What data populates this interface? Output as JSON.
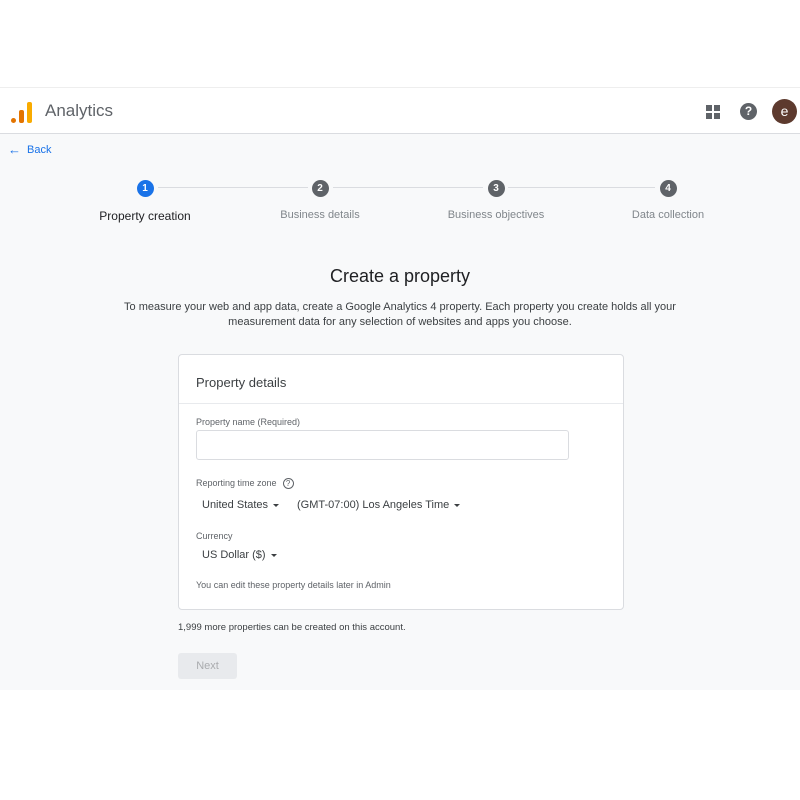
{
  "header": {
    "brand": "Analytics",
    "avatar_letter": "e",
    "icons": [
      "apps-grid-icon",
      "help-icon",
      "avatar"
    ]
  },
  "colors": {
    "accent": "#1a73e8",
    "logo_orange": "#e37400",
    "logo_yellow": "#f9ab00",
    "avatar": "#5d3a2e"
  },
  "nav": {
    "back_label": "Back"
  },
  "stepper": {
    "steps": [
      {
        "number": "1",
        "label": "Property creation",
        "active": true
      },
      {
        "number": "2",
        "label": "Business details",
        "active": false
      },
      {
        "number": "3",
        "label": "Business objectives",
        "active": false
      },
      {
        "number": "4",
        "label": "Data collection",
        "active": false
      }
    ]
  },
  "page": {
    "title": "Create a property",
    "description": "To measure your web and app data, create a Google Analytics 4 property. Each property you create holds all your measurement data for any selection of websites and apps you choose."
  },
  "card": {
    "title": "Property details",
    "property_name_label": "Property name (Required)",
    "property_name_value": "",
    "timezone_label": "Reporting time zone",
    "country": "United States",
    "timezone": "(GMT-07:00) Los Angeles Time",
    "currency_label": "Currency",
    "currency": "US Dollar ($)",
    "note": "You can edit these property details later in Admin"
  },
  "footer": {
    "remaining": "1,999 more properties can be created on this account.",
    "next_label": "Next",
    "next_disabled": true
  }
}
